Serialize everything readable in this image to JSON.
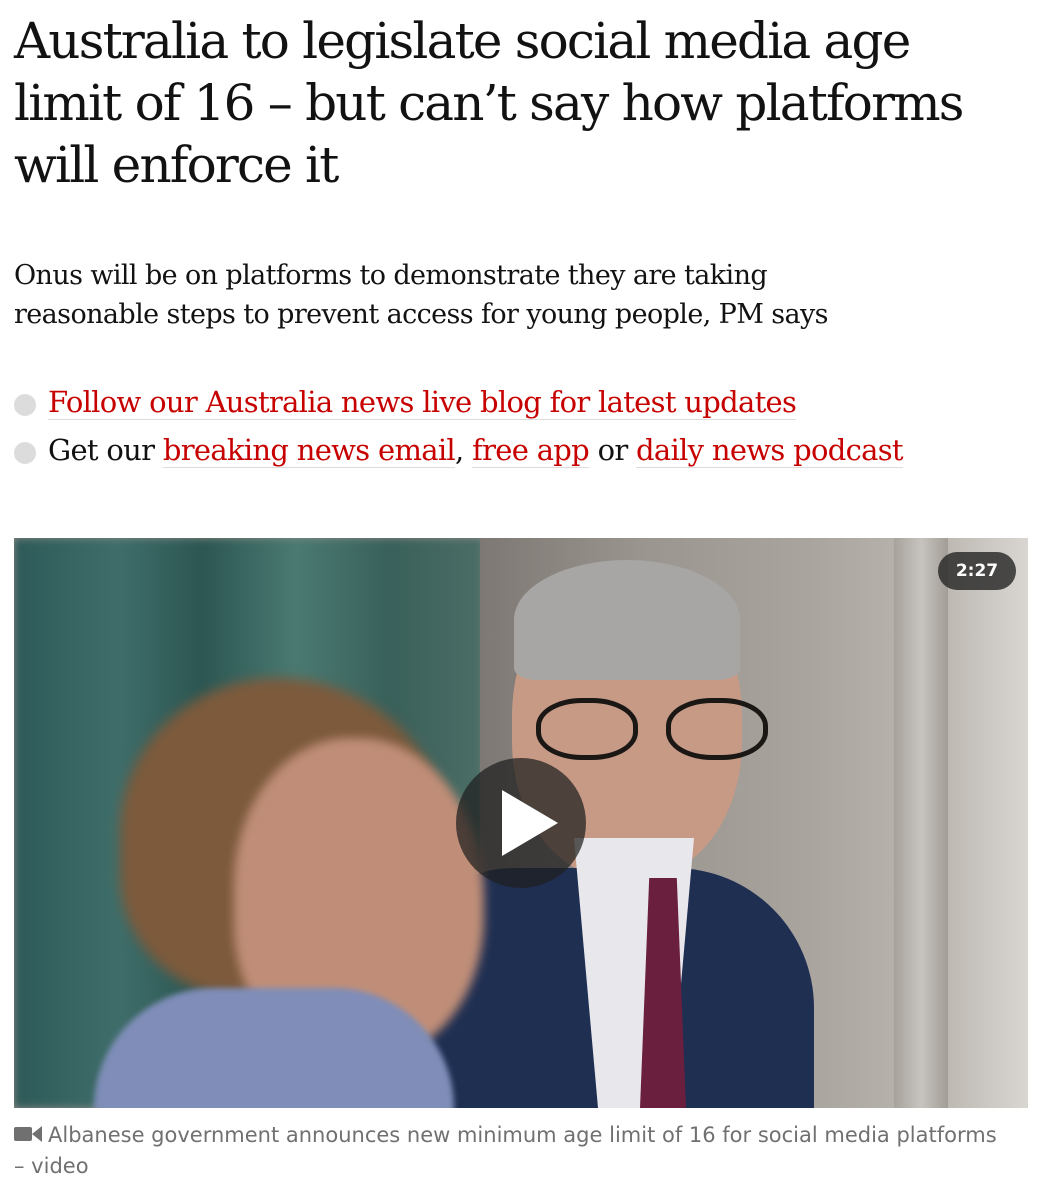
{
  "article": {
    "headline": "Australia to legislate social media age limit of 16 – but can’t say how platforms will enforce it",
    "standfirst": "Onus will be on platforms to demonstrate they are taking reasonable steps to prevent access for young people, PM says"
  },
  "bullets": [
    {
      "link": "Follow our Australia news live blog for latest updates"
    },
    {
      "prefix": "Get our",
      "link1": "breaking news email",
      "sep1": ",",
      "link2": "free app",
      "sep2": "or",
      "link3": "daily news podcast"
    }
  ],
  "media": {
    "duration": "2:27",
    "caption": "Albanese government announces new minimum age limit of 16 for social media platforms – video",
    "caption_icon": "video-camera-icon"
  },
  "colors": {
    "link": "#c70000",
    "text": "#121212",
    "caption": "#707070",
    "bullet": "#dcdcdc"
  }
}
